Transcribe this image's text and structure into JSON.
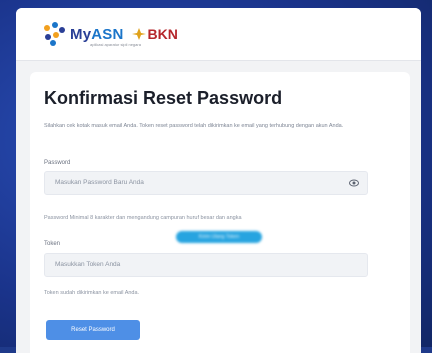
{
  "header": {
    "brand_prefix": "My",
    "brand_asn": "ASN",
    "brand_sub": "aplikasi aparatur sipil negara",
    "bkn_label": "BKN"
  },
  "form": {
    "title": "Konfirmasi Reset Password",
    "description": "Silahkan cek kotak masuk email Anda. Token reset password telah dikirimkan ke email yang terhubung dengan akun Anda.",
    "password_label": "Password",
    "password_placeholder": "Masukan Password Baru Anda",
    "password_hint": "Password Minimal 8 karakter dan mengandung campuran huruf besar dan angka",
    "token_label": "Token",
    "token_placeholder": "Masukkan Token Anda",
    "token_hint": "Token sudah dikirimkan ke email Anda.",
    "resend_link": "Kirim Ulang Token",
    "submit_label": "Reset Password"
  },
  "colors": {
    "brand_blue": "#2a3f96",
    "bkn_red": "#b5262b",
    "button": "#4e8fe6",
    "link": "#27a4e0"
  },
  "icons": {
    "show_password": "eye-icon"
  }
}
